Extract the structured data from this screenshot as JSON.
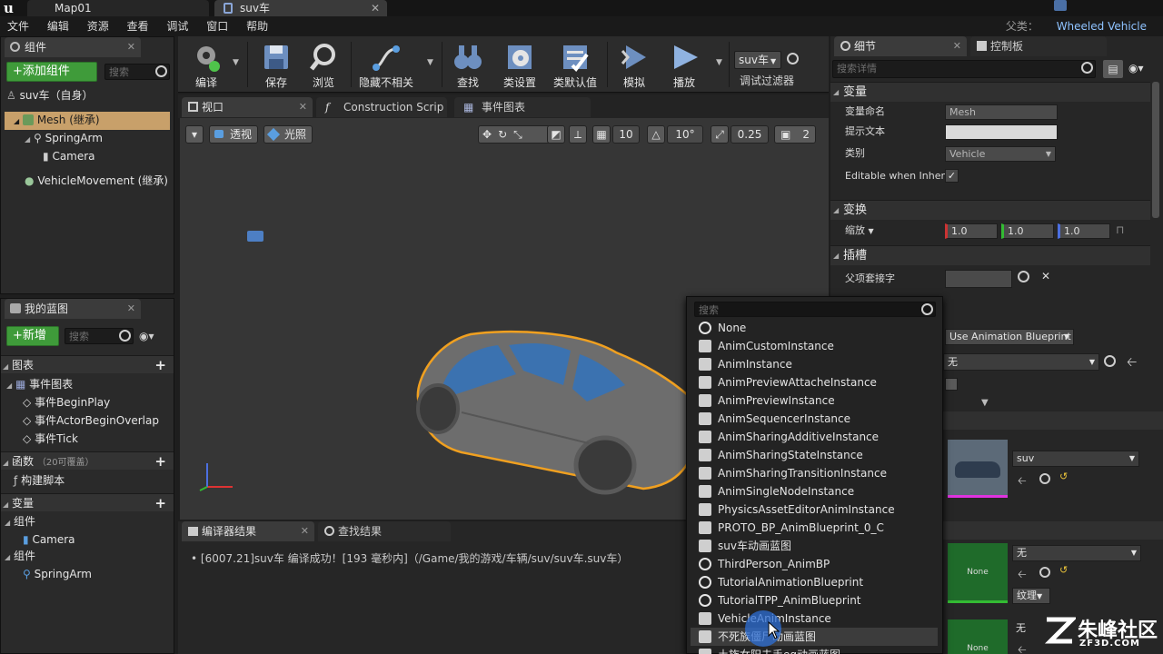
{
  "window": {
    "tabs": [
      "Map01",
      "suv车"
    ],
    "parent_class_label": "父类：",
    "parent_class": "Wheeled Vehicle"
  },
  "menu": [
    "文件",
    "编辑",
    "资源",
    "查看",
    "调试",
    "窗口",
    "帮助"
  ],
  "components_panel": {
    "title": "组件",
    "add_button": "+添加组件",
    "search_placeholder": "搜索",
    "root": "suv车（自身）",
    "tree": [
      "Mesh (继承)",
      "SpringArm",
      "Camera",
      "VehicleMovement (继承)"
    ]
  },
  "toolbar": {
    "items": [
      "编译",
      "保存",
      "浏览",
      "隐藏不相关",
      "查找",
      "类设置",
      "类默认值",
      "模拟",
      "播放"
    ],
    "debug_object": "suv车",
    "debug_filter": "调试过滤器"
  },
  "editor_tabs": [
    "视口",
    "Construction Scrip",
    "事件图表"
  ],
  "viewport": {
    "perspective": "透视",
    "lit": "光照",
    "grid_snap": "10",
    "rot_snap": "10°",
    "scale_snap": "0.25",
    "camera_speed": "2"
  },
  "my_blueprint": {
    "title": "我的蓝图",
    "new_button": "+新增",
    "search_placeholder": "搜索",
    "graphs_label": "图表",
    "event_graph": "事件图表",
    "events": [
      "事件BeginPlay",
      "事件ActorBeginOverlap",
      "事件Tick"
    ],
    "functions_label": "函数",
    "functions_override": "（20可覆盖）",
    "construction_script": "构建脚本",
    "variables_label": "变量",
    "component_group_label": "组件",
    "var_camera": "Camera",
    "var_springarm": "SpringArm"
  },
  "output": {
    "tabs": [
      "编译器结果",
      "查找结果"
    ],
    "log_line": "[6007.21]suv车 编译成功！[193 毫秒内]（/Game/我的游戏/车辆/suv/suv车.suv车）"
  },
  "details": {
    "tabs": [
      "细节",
      "控制板"
    ],
    "search_placeholder": "搜索详情",
    "cat_variable": "变量",
    "var_name_label": "变量命名",
    "var_name_value": "Mesh",
    "tooltip_label": "提示文本",
    "category_label": "类别",
    "category_value": "Vehicle",
    "editable_label": "Editable when Inherit",
    "editable_checked": true,
    "cat_transform": "变换",
    "scale_label": "缩放",
    "scale_values": [
      "1.0",
      "1.0",
      "1.0"
    ],
    "cat_sockets": "插槽",
    "parent_socket_label": "父项套接字",
    "anim_mode": "Use Animation Blueprint",
    "anim_class": "无",
    "mesh_value": "suv",
    "material_value1": "无",
    "material_value2": "无",
    "texture_label": "纹理",
    "thumb_none": "None"
  },
  "picker": {
    "search_placeholder": "搜索",
    "items": [
      {
        "label": "None",
        "icon": "circle"
      },
      {
        "label": "AnimCustomInstance",
        "icon": "class"
      },
      {
        "label": "AnimInstance",
        "icon": "class"
      },
      {
        "label": "AnimPreviewAttacheInstance",
        "icon": "class"
      },
      {
        "label": "AnimPreviewInstance",
        "icon": "class"
      },
      {
        "label": "AnimSequencerInstance",
        "icon": "class"
      },
      {
        "label": "AnimSharingAdditiveInstance",
        "icon": "class"
      },
      {
        "label": "AnimSharingStateInstance",
        "icon": "class"
      },
      {
        "label": "AnimSharingTransitionInstance",
        "icon": "class"
      },
      {
        "label": "AnimSingleNodeInstance",
        "icon": "class"
      },
      {
        "label": "PhysicsAssetEditorAnimInstance",
        "icon": "class"
      },
      {
        "label": "PROTO_BP_AnimBlueprint_0_C",
        "icon": "class"
      },
      {
        "label": "suv车动画蓝图",
        "icon": "class"
      },
      {
        "label": "ThirdPerson_AnimBP",
        "icon": "circle"
      },
      {
        "label": "TutorialAnimationBlueprint",
        "icon": "circle"
      },
      {
        "label": "TutorialTPP_AnimBlueprint",
        "icon": "circle"
      },
      {
        "label": "VehicleAnimInstance",
        "icon": "class"
      },
      {
        "label": "不死族僵尸动画蓝图",
        "icon": "class"
      },
      {
        "label": "土族女阳夫手eg动画蓝图",
        "icon": "class"
      }
    ]
  },
  "watermark": {
    "brand": "朱峰社区",
    "url": "ZF3D.COM"
  },
  "colors": {
    "accent_green": "#3f9b3a",
    "selection": "#c8a06a",
    "link_blue": "#8fc3ff",
    "outline_orange": "#f0a020"
  }
}
